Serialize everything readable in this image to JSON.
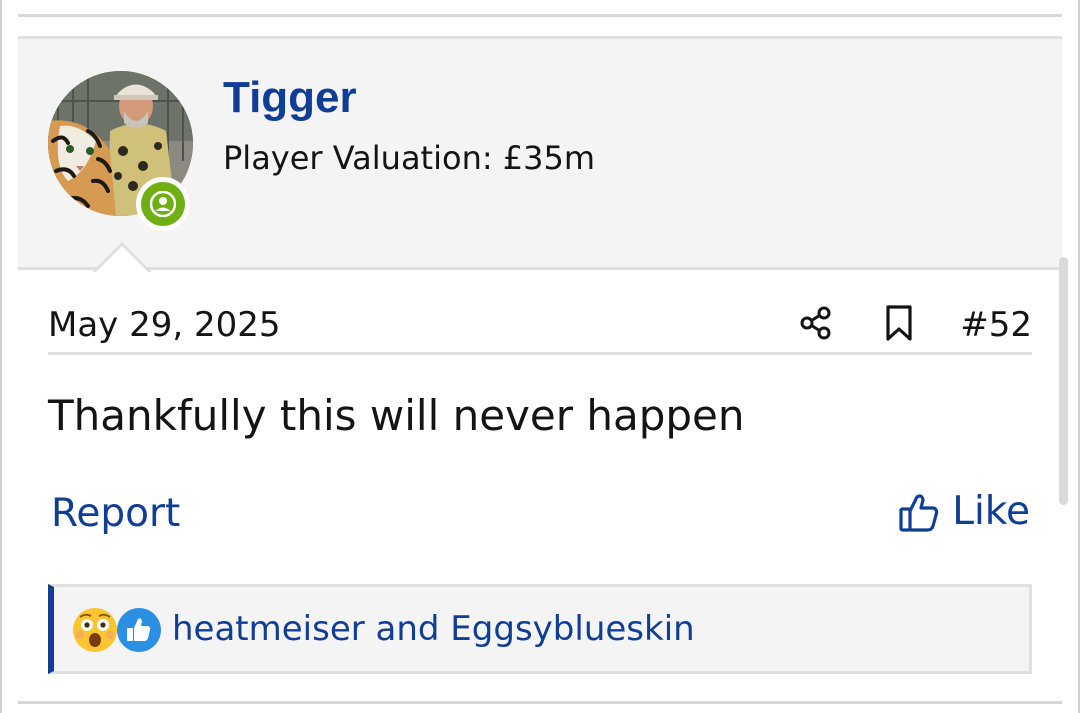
{
  "post": {
    "author": {
      "name": "Tigger",
      "title": "Player Valuation: £35m",
      "online": true,
      "avatar_icon": "avatar-photo-tiger"
    },
    "date": "May 29, 2025",
    "number": "#52",
    "body": "Thankfully this will never happen",
    "actions": {
      "report_label": "Report",
      "like_label": "Like",
      "share_icon": "share-icon",
      "bookmark_icon": "bookmark-icon",
      "like_icon": "thumbs-up-icon"
    },
    "reactions": {
      "icons": [
        "shocked-emoji-icon",
        "like-reaction-icon"
      ],
      "users_text": "heatmeiser and Eggsyblueskin"
    }
  },
  "colors": {
    "link_blue": "#103e96",
    "online_green": "#6faf14",
    "header_bg": "#f4f4f4",
    "like_reaction_blue": "#2b8fe3"
  }
}
